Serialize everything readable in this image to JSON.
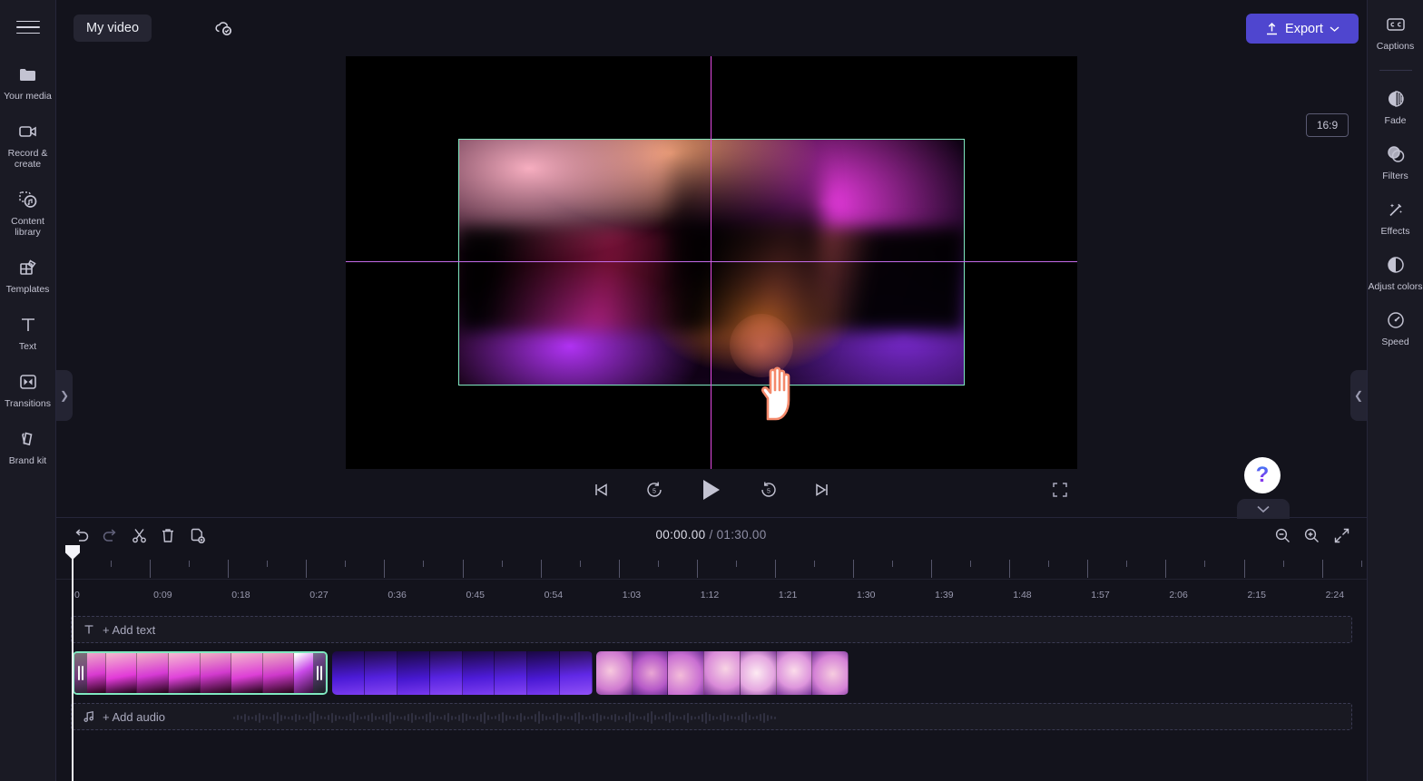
{
  "app": {
    "title": "My video",
    "cloud_status_icon": "cloud-saved-check-icon",
    "menu_icon": "hamburger-menu-icon"
  },
  "topbar": {
    "export_label": "Export",
    "export_icon": "upload-arrow-icon",
    "export_chevron": "chevron-down-icon",
    "export_color": "#4f46cf"
  },
  "sidebar": {
    "items": [
      {
        "label": "Your media",
        "icon": "folder-icon"
      },
      {
        "label": "Record & create",
        "icon": "video-camera-icon"
      },
      {
        "label": "Content library",
        "icon": "content-library-icon"
      },
      {
        "label": "Templates",
        "icon": "templates-icon"
      },
      {
        "label": "Text",
        "icon": "text-t-icon"
      },
      {
        "label": "Transitions",
        "icon": "transitions-icon"
      },
      {
        "label": "Brand kit",
        "icon": "brand-kit-icon"
      }
    ],
    "collapse_icon": "chevron-right-icon"
  },
  "right_panel": {
    "items": [
      {
        "label": "Captions",
        "icon": "closed-captions-icon"
      },
      {
        "label": "Fade",
        "icon": "fade-circle-icon"
      },
      {
        "label": "Filters",
        "icon": "filters-overlap-icon"
      },
      {
        "label": "Effects",
        "icon": "magic-wand-icon"
      },
      {
        "label": "Adjust colors",
        "icon": "half-circle-contrast-icon"
      },
      {
        "label": "Speed",
        "icon": "speedometer-icon"
      }
    ],
    "collapse_icon": "chevron-left-icon"
  },
  "preview": {
    "aspect_ratio": "16:9",
    "selection_color": "#7fe8c0",
    "guide_color": "#e24ae2",
    "cursor_icon": "hand-pointer-cursor",
    "click_ripple": "click-ripple-indicator",
    "fullscreen_icon": "fullscreen-expand-icon",
    "help_label": "?",
    "collapse_chevron": "chevron-down-icon"
  },
  "transport": {
    "buttons": [
      {
        "name": "skip-to-start",
        "icon": "skip-previous-icon"
      },
      {
        "name": "rewind-5",
        "icon": "replay-5-icon",
        "value": "5"
      },
      {
        "name": "play",
        "icon": "play-triangle-icon"
      },
      {
        "name": "forward-5",
        "icon": "forward-5-icon",
        "value": "5"
      },
      {
        "name": "skip-to-end",
        "icon": "skip-next-icon"
      }
    ]
  },
  "timeline": {
    "current_time": "00:00.00",
    "separator": "/",
    "duration": "01:30.00",
    "tools": [
      {
        "name": "undo",
        "icon": "undo-arrow-icon"
      },
      {
        "name": "redo",
        "icon": "redo-arrow-icon"
      },
      {
        "name": "split",
        "icon": "scissors-icon"
      },
      {
        "name": "delete",
        "icon": "trash-can-icon"
      },
      {
        "name": "duplicate",
        "icon": "duplicate-page-icon"
      }
    ],
    "zoom_tools": [
      {
        "name": "zoom-out",
        "icon": "magnifier-minus-icon"
      },
      {
        "name": "zoom-in",
        "icon": "magnifier-plus-icon"
      },
      {
        "name": "fit-to-screen",
        "icon": "fit-arrows-icon"
      }
    ],
    "ruler_labels": [
      "0",
      "0:09",
      "0:18",
      "0:27",
      "0:36",
      "0:45",
      "0:54",
      "1:03",
      "1:12",
      "1:21",
      "1:30",
      "1:39",
      "1:48",
      "1:57",
      "2:06",
      "2:15",
      "2:24"
    ],
    "text_track_label": "+ Add text",
    "text_track_icon": "text-t-icon",
    "audio_track_label": "+ Add audio",
    "audio_track_icon": "music-note-icon",
    "playhead_position": "0",
    "clips": [
      {
        "name": "clip-pink-gradient",
        "selected": true
      },
      {
        "name": "clip-blue-purple",
        "selected": false
      },
      {
        "name": "clip-pink-bubbles",
        "selected": false
      }
    ]
  }
}
